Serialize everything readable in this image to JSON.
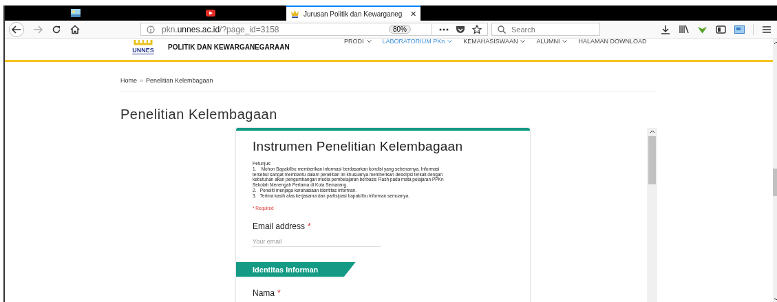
{
  "browser": {
    "tabs": [
      {
        "kind": "pinned-photo",
        "selected": false
      },
      {
        "kind": "pinned-video",
        "selected": false
      },
      {
        "kind": "page",
        "title": "Jurusan Politik dan Kewarganeg",
        "close": "✕",
        "selected": true
      }
    ],
    "url": {
      "host_prefix": "pkn.",
      "host": "unnes.ac.id",
      "path": "/?page_id=3158"
    },
    "zoom": "80%",
    "search_placeholder": "Search"
  },
  "site": {
    "logo_text": "UNNES",
    "title": "POLITIK DAN KEWARGANEGARAAN",
    "nav": [
      {
        "label": "PRODI",
        "dropdown": true,
        "selected": false
      },
      {
        "label": "LABORATORIUM PKn",
        "dropdown": true,
        "selected": true
      },
      {
        "label": "KEMAHASISWAAN",
        "dropdown": true,
        "selected": false
      },
      {
        "label": "ALUMNI",
        "dropdown": true,
        "selected": false
      },
      {
        "label": "HALAMAN DOWNLOAD",
        "dropdown": false,
        "selected": false
      }
    ]
  },
  "breadcrumb": [
    "Home",
    "»",
    "Penelitian Kelembagaan"
  ],
  "page_title": "Penelitian Kelembagaan",
  "form": {
    "title": "Instrumen Penelitian Kelembagaan",
    "instructions": [
      "Petunjuk:",
      "1.    Mohon Bapak/Ibu memberikan informasi berdasarkan kondisi yang sebenarnya. Informasi",
      "tersebut sangat membantu dalam penelitian ini khusuanya memberikan deskripsi terkait dengan",
      "kebutuhan akan pengembangan media pembelajaran berbasis Flash pada mata pelajaran PPKn",
      "Sekolah Menengah Pertama di Kota Semarang.",
      "2.   Peneliti menjaga kerahasiaan identitas informan.",
      "3.   Terima kasih atas kerjasama dan partisipasi bapak/Ibu informan semuanya."
    ],
    "required_note": "* Required",
    "email": {
      "label": "Email address",
      "required": "*",
      "placeholder": "Your email"
    },
    "section": "Identitas Informan",
    "next": {
      "label": "Nama",
      "required": "*"
    }
  }
}
